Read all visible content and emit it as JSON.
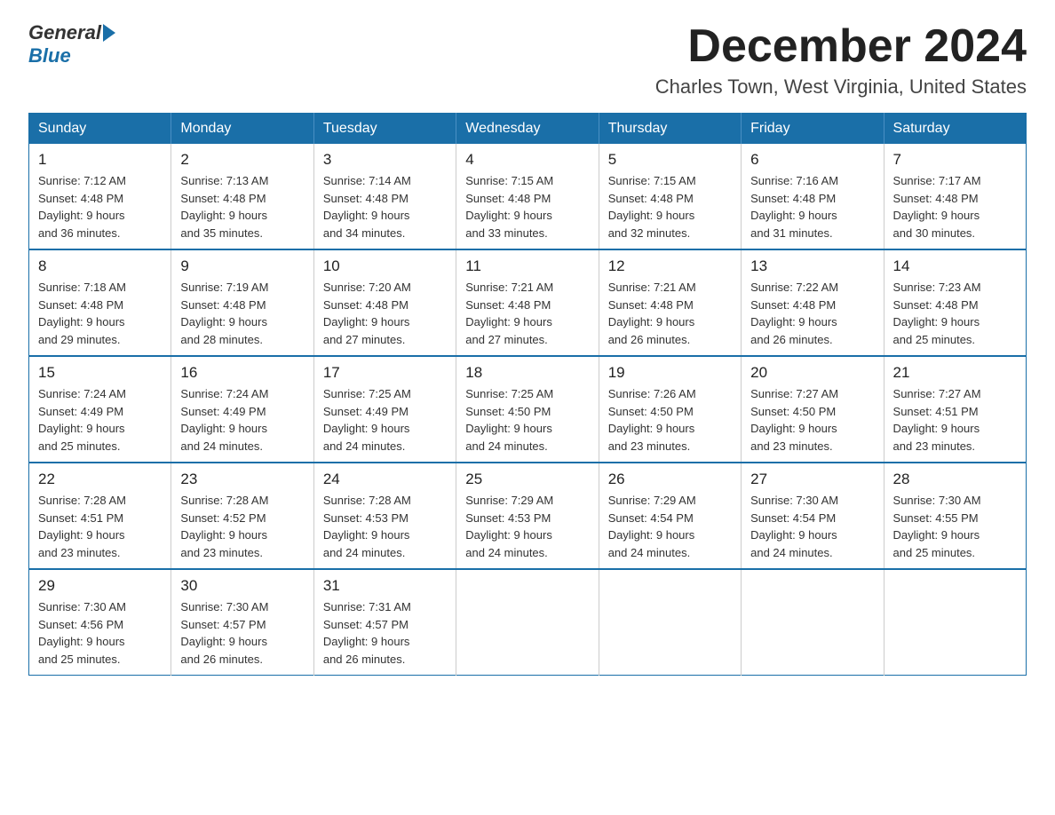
{
  "logo": {
    "general": "General",
    "blue": "Blue"
  },
  "title": {
    "month": "December 2024",
    "location": "Charles Town, West Virginia, United States"
  },
  "days_header": [
    "Sunday",
    "Monday",
    "Tuesday",
    "Wednesday",
    "Thursday",
    "Friday",
    "Saturday"
  ],
  "weeks": [
    [
      {
        "day": "1",
        "sunrise": "7:12 AM",
        "sunset": "4:48 PM",
        "daylight": "9 hours and 36 minutes."
      },
      {
        "day": "2",
        "sunrise": "7:13 AM",
        "sunset": "4:48 PM",
        "daylight": "9 hours and 35 minutes."
      },
      {
        "day": "3",
        "sunrise": "7:14 AM",
        "sunset": "4:48 PM",
        "daylight": "9 hours and 34 minutes."
      },
      {
        "day": "4",
        "sunrise": "7:15 AM",
        "sunset": "4:48 PM",
        "daylight": "9 hours and 33 minutes."
      },
      {
        "day": "5",
        "sunrise": "7:15 AM",
        "sunset": "4:48 PM",
        "daylight": "9 hours and 32 minutes."
      },
      {
        "day": "6",
        "sunrise": "7:16 AM",
        "sunset": "4:48 PM",
        "daylight": "9 hours and 31 minutes."
      },
      {
        "day": "7",
        "sunrise": "7:17 AM",
        "sunset": "4:48 PM",
        "daylight": "9 hours and 30 minutes."
      }
    ],
    [
      {
        "day": "8",
        "sunrise": "7:18 AM",
        "sunset": "4:48 PM",
        "daylight": "9 hours and 29 minutes."
      },
      {
        "day": "9",
        "sunrise": "7:19 AM",
        "sunset": "4:48 PM",
        "daylight": "9 hours and 28 minutes."
      },
      {
        "day": "10",
        "sunrise": "7:20 AM",
        "sunset": "4:48 PM",
        "daylight": "9 hours and 27 minutes."
      },
      {
        "day": "11",
        "sunrise": "7:21 AM",
        "sunset": "4:48 PM",
        "daylight": "9 hours and 27 minutes."
      },
      {
        "day": "12",
        "sunrise": "7:21 AM",
        "sunset": "4:48 PM",
        "daylight": "9 hours and 26 minutes."
      },
      {
        "day": "13",
        "sunrise": "7:22 AM",
        "sunset": "4:48 PM",
        "daylight": "9 hours and 26 minutes."
      },
      {
        "day": "14",
        "sunrise": "7:23 AM",
        "sunset": "4:48 PM",
        "daylight": "9 hours and 25 minutes."
      }
    ],
    [
      {
        "day": "15",
        "sunrise": "7:24 AM",
        "sunset": "4:49 PM",
        "daylight": "9 hours and 25 minutes."
      },
      {
        "day": "16",
        "sunrise": "7:24 AM",
        "sunset": "4:49 PM",
        "daylight": "9 hours and 24 minutes."
      },
      {
        "day": "17",
        "sunrise": "7:25 AM",
        "sunset": "4:49 PM",
        "daylight": "9 hours and 24 minutes."
      },
      {
        "day": "18",
        "sunrise": "7:25 AM",
        "sunset": "4:50 PM",
        "daylight": "9 hours and 24 minutes."
      },
      {
        "day": "19",
        "sunrise": "7:26 AM",
        "sunset": "4:50 PM",
        "daylight": "9 hours and 23 minutes."
      },
      {
        "day": "20",
        "sunrise": "7:27 AM",
        "sunset": "4:50 PM",
        "daylight": "9 hours and 23 minutes."
      },
      {
        "day": "21",
        "sunrise": "7:27 AM",
        "sunset": "4:51 PM",
        "daylight": "9 hours and 23 minutes."
      }
    ],
    [
      {
        "day": "22",
        "sunrise": "7:28 AM",
        "sunset": "4:51 PM",
        "daylight": "9 hours and 23 minutes."
      },
      {
        "day": "23",
        "sunrise": "7:28 AM",
        "sunset": "4:52 PM",
        "daylight": "9 hours and 23 minutes."
      },
      {
        "day": "24",
        "sunrise": "7:28 AM",
        "sunset": "4:53 PM",
        "daylight": "9 hours and 24 minutes."
      },
      {
        "day": "25",
        "sunrise": "7:29 AM",
        "sunset": "4:53 PM",
        "daylight": "9 hours and 24 minutes."
      },
      {
        "day": "26",
        "sunrise": "7:29 AM",
        "sunset": "4:54 PM",
        "daylight": "9 hours and 24 minutes."
      },
      {
        "day": "27",
        "sunrise": "7:30 AM",
        "sunset": "4:54 PM",
        "daylight": "9 hours and 24 minutes."
      },
      {
        "day": "28",
        "sunrise": "7:30 AM",
        "sunset": "4:55 PM",
        "daylight": "9 hours and 25 minutes."
      }
    ],
    [
      {
        "day": "29",
        "sunrise": "7:30 AM",
        "sunset": "4:56 PM",
        "daylight": "9 hours and 25 minutes."
      },
      {
        "day": "30",
        "sunrise": "7:30 AM",
        "sunset": "4:57 PM",
        "daylight": "9 hours and 26 minutes."
      },
      {
        "day": "31",
        "sunrise": "7:31 AM",
        "sunset": "4:57 PM",
        "daylight": "9 hours and 26 minutes."
      },
      null,
      null,
      null,
      null
    ]
  ]
}
